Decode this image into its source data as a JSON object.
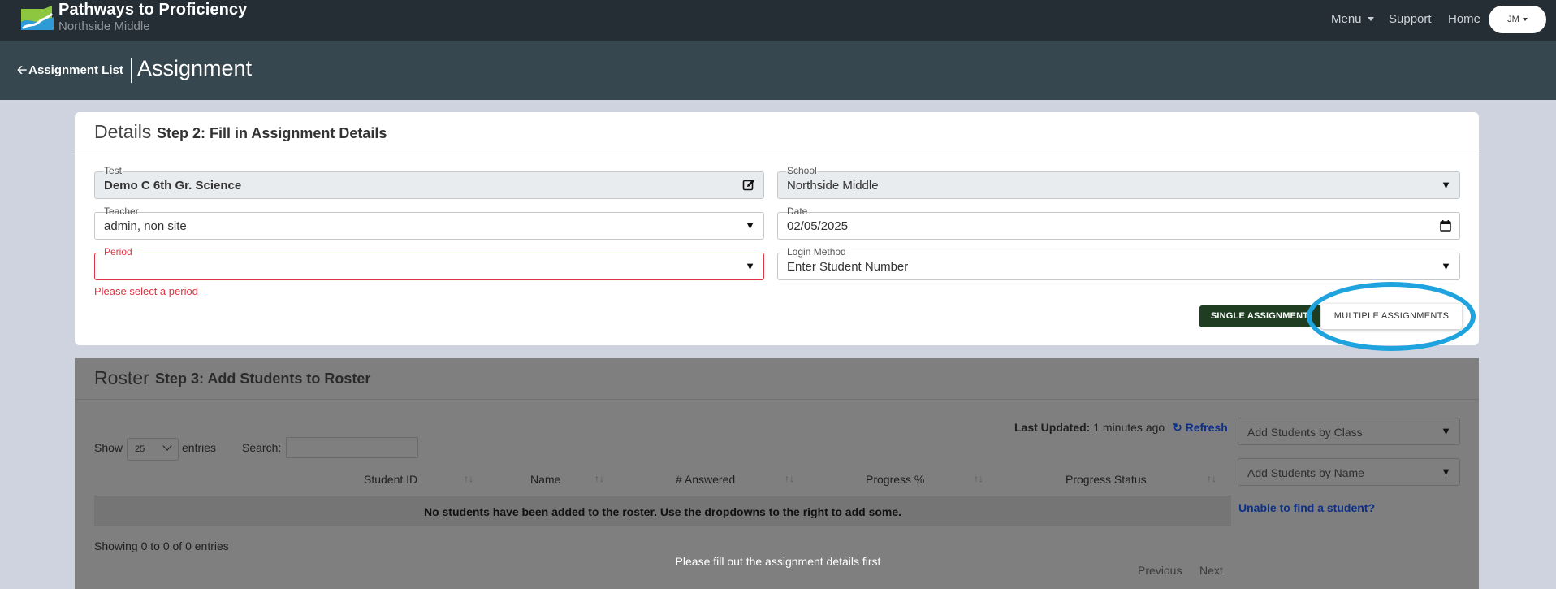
{
  "header": {
    "brand_title": "Pathways to Proficiency",
    "brand_subtitle": "Northside Middle",
    "nav": {
      "menu": "Menu",
      "support": "Support",
      "home": "Home"
    },
    "user_initials": "JM"
  },
  "subheader": {
    "back_label": "Assignment List",
    "title": "Assignment"
  },
  "details": {
    "title": "Details",
    "step": "Step 2: Fill in Assignment Details",
    "fields": {
      "test": {
        "label": "Test",
        "value": "Demo C 6th Gr. Science"
      },
      "school": {
        "label": "School",
        "value": "Northside Middle"
      },
      "teacher": {
        "label": "Teacher",
        "value": "admin, non site"
      },
      "date": {
        "label": "Date",
        "value": "02/05/2025"
      },
      "period": {
        "label": "Period",
        "value": ""
      },
      "login_method": {
        "label": "Login Method",
        "value": "Enter Student Number"
      }
    },
    "period_error": "Please select a period",
    "buttons": {
      "single": "SINGLE ASSIGNMENT",
      "multiple": "MULTIPLE ASSIGNMENTS"
    }
  },
  "roster": {
    "title": "Roster",
    "step": "Step 3: Add Students to Roster",
    "last_updated_label": "Last Updated:",
    "last_updated_value": "1 minutes ago",
    "refresh": "Refresh",
    "show_label": "Show",
    "show_value": "25",
    "entries_label": "entries",
    "search_label": "Search:",
    "columns": [
      "Student ID",
      "Name",
      "# Answered",
      "Progress %",
      "Progress Status"
    ],
    "empty_message": "No students have been added to the roster. Use the dropdowns to the right to add some.",
    "info": "Showing 0 to 0 of 0 entries",
    "add_by_class": "Add Students by Class",
    "add_by_name": "Add Students by Name",
    "unable": "Unable to find a student?",
    "notice": "Please fill out the assignment details first",
    "pager": {
      "previous": "Previous",
      "next": "Next"
    }
  },
  "colors": {
    "topbar": "#252e35",
    "subbar": "#37474f",
    "primary_button": "#1e3d21",
    "highlight": "#1ea3df",
    "error": "#dc3545"
  }
}
